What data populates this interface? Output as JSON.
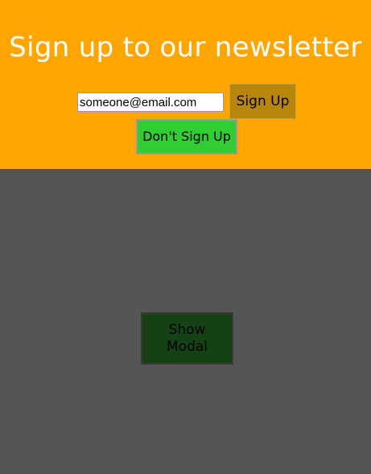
{
  "newsletter": {
    "title": "Sign up to our newsletter",
    "email_value": "someone@email.com",
    "signup_label": "Sign Up",
    "dont_signup_label": "Don't Sign Up"
  },
  "main": {
    "show_modal_line1": "Show",
    "show_modal_line2": "Modal"
  },
  "colors": {
    "header_background": "#ffa500",
    "page_background": "#555555",
    "signup_button": "#b8860b",
    "dont_signup_button": "#32cd32",
    "show_modal_button": "#144214"
  }
}
